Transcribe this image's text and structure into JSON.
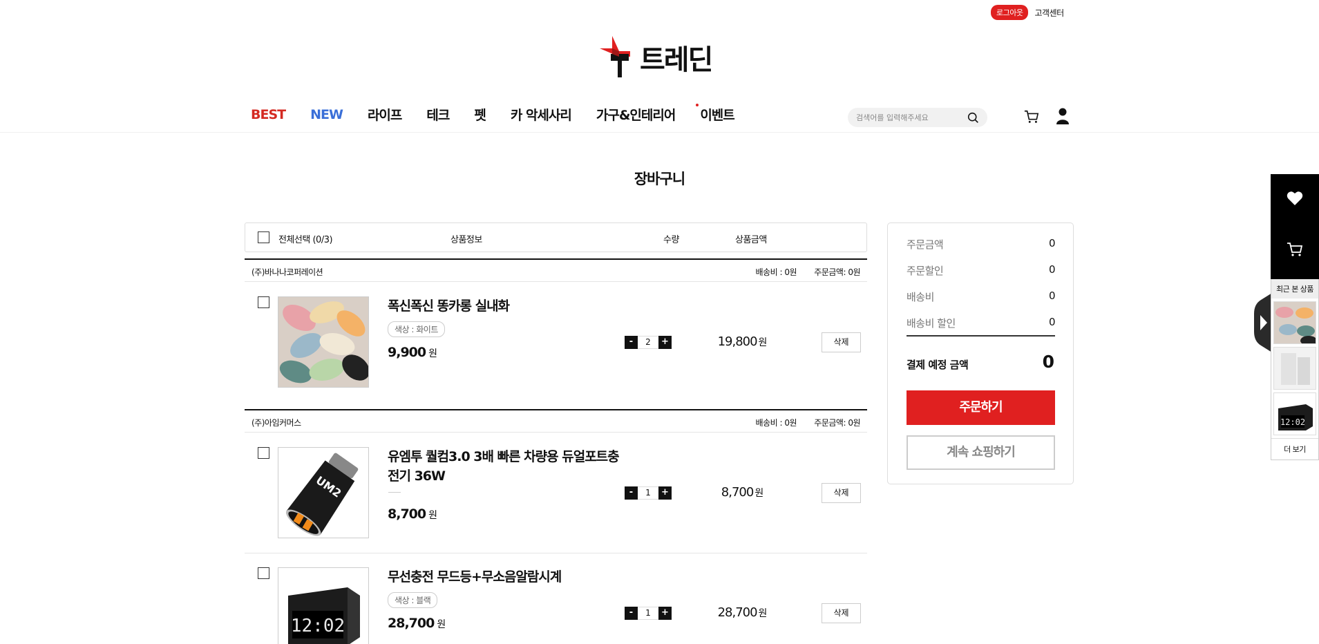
{
  "header": {
    "logout_label": "로그아웃",
    "cs_label": "고객센터",
    "logo_text": "트레딘",
    "search_placeholder": "검색어를 입력해주세요"
  },
  "nav": {
    "items": [
      "BEST",
      "NEW",
      "라이프",
      "테크",
      "펫",
      "카 악세사리",
      "가구&인테리어",
      "이벤트"
    ]
  },
  "page": {
    "title": "장바구니"
  },
  "list_header": {
    "select_all": "전체선택 (0/3)",
    "info": "상품정보",
    "qty": "수량",
    "price": "상품금액"
  },
  "sellers": [
    {
      "name": "(주)바나나코퍼레이션",
      "shipping": "배송비 : 0원",
      "total": "주문금액: 0원"
    },
    {
      "name": "(주)아임커머스",
      "shipping": "배송비 : 0원",
      "total": "주문금액: 0원"
    }
  ],
  "items": [
    {
      "name": "폭신폭신 똥카롱 실내화",
      "option": "색상 : 화이트",
      "unit_price": "9,900",
      "qty": "2",
      "line_price": "19,800",
      "delete": "삭제"
    },
    {
      "name": "유엠투 퀄컴3.0 3배 빠른 차량용 듀얼포트충전기 36W",
      "option": "",
      "unit_price": "8,700",
      "qty": "1",
      "line_price": "8,700",
      "delete": "삭제"
    },
    {
      "name": "무선충전 무드등+무소음알람시계",
      "option": "색상 : 블랙",
      "unit_price": "28,700",
      "qty": "1",
      "line_price": "28,700",
      "delete": "삭제"
    }
  ],
  "currency": "원",
  "qty_minus": "-",
  "qty_plus": "+",
  "summary": {
    "order_amount_label": "주문금액",
    "order_amount": "0",
    "order_discount_label": "주문할인",
    "order_discount": "0",
    "shipping_label": "배송비",
    "shipping": "0",
    "shipping_discount_label": "배송비 할인",
    "shipping_discount": "0",
    "total_label": "결제 예정 금액",
    "total": "0",
    "order_button": "주문하기",
    "continue_button": "계속 쇼핑하기"
  },
  "quick": {
    "recent_title": "최근 본 상품",
    "more": "더 보기"
  },
  "colors": {
    "accent": "#e02020",
    "best": "#d42a22",
    "new": "#3a6fd8"
  }
}
